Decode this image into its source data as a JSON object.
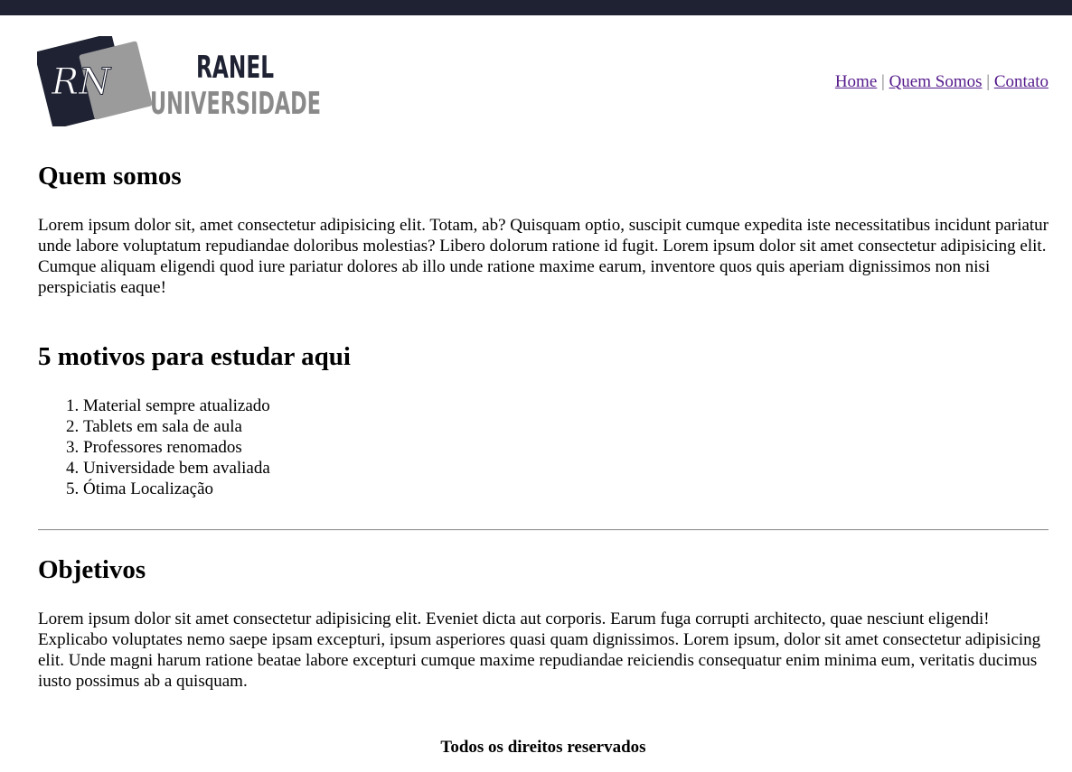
{
  "logo": {
    "initials": "RN",
    "line1": "RANEL",
    "line2": "UNIVERSIDADE",
    "colors": {
      "dark": "#1f2233",
      "gray": "#9b9b9b",
      "text_gray": "#8a8a8a"
    }
  },
  "nav": {
    "items": [
      {
        "label": "Home"
      },
      {
        "label": "Quem Somos"
      },
      {
        "label": "Contato"
      }
    ],
    "separator": "|"
  },
  "sections": {
    "about": {
      "title": "Quem somos",
      "text": "Lorem ipsum dolor sit, amet consectetur adipisicing elit. Totam, ab? Quisquam optio, suscipit cumque expedita iste necessitatibus incidunt pariatur unde labore voluptatum repudiandae doloribus molestias? Libero dolorum ratione id fugit. Lorem ipsum dolor sit amet consectetur adipisicing elit. Cumque aliquam eligendi quod iure pariatur dolores ab illo unde ratione maxime earum, inventore quos quis aperiam dignissimos non nisi perspiciatis eaque!"
    },
    "reasons": {
      "title": "5 motivos para estudar aqui",
      "items": [
        "Material sempre atualizado",
        "Tablets em sala de aula",
        "Professores renomados",
        "Universidade bem avaliada",
        "Ótima Localização"
      ]
    },
    "goals": {
      "title": "Objetivos",
      "text": "Lorem ipsum dolor sit amet consectetur adipisicing elit. Eveniet dicta aut corporis. Earum fuga corrupti architecto, quae nesciunt eligendi! Explicabo voluptates nemo saepe ipsam excepturi, ipsum asperiores quasi quam dignissimos. Lorem ipsum, dolor sit amet consectetur adipisicing elit. Unde magni harum ratione beatae labore excepturi cumque maxime repudiandae reiciendis consequatur enim minima eum, veritatis ducimus iusto possimus ab a quisquam."
    }
  },
  "footer": {
    "text": "Todos os direitos reservados"
  },
  "theme": {
    "top_bar": "#1f2233",
    "link": "#551a8b"
  }
}
